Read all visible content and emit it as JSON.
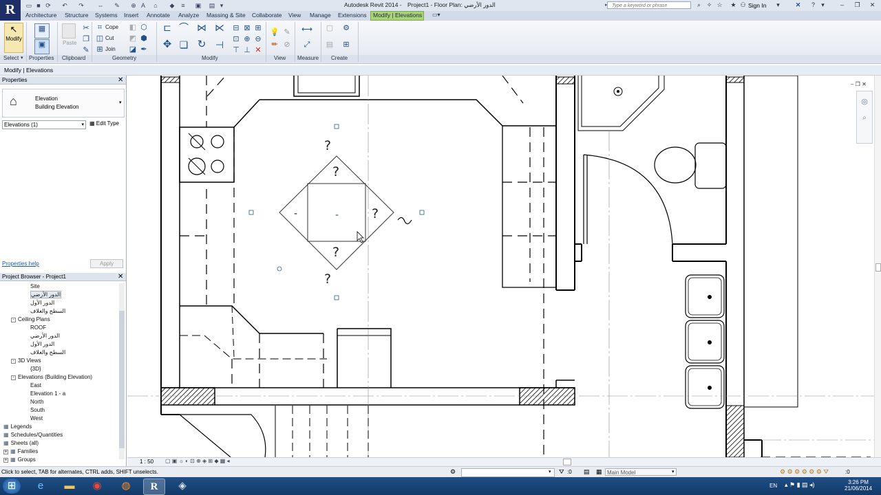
{
  "title_bar": {
    "app_title": "Autodesk Revit 2014 -",
    "doc_title": "Project1 - Floor Plan: الدور الأرضي",
    "search_placeholder": "Type a keyword or phrase",
    "sign_in": "Sign In",
    "app_logo": "R"
  },
  "tabs": [
    "Architecture",
    "Structure",
    "Systems",
    "Insert",
    "Annotate",
    "Analyze",
    "Massing & Site",
    "Collaborate",
    "View",
    "Manage",
    "Extensions",
    "Modify | Elevations"
  ],
  "ribbon": {
    "modify_label": "Modify",
    "paste_label": "Paste",
    "cope_label": "Cope",
    "cut_label": "Cut",
    "join_label": "Join",
    "panels": [
      "Select",
      "Properties",
      "Clipboard",
      "Geometry",
      "Modify",
      "View",
      "Measure",
      "Create"
    ]
  },
  "context_bar": {
    "label": "Modify | Elevations"
  },
  "properties": {
    "header": "Properties",
    "type_name": "Elevation",
    "type_sub": "Building Elevation",
    "instance_selector": "Elevations (1)",
    "edit_type": "Edit Type",
    "help_link": "Properties help",
    "apply_button": "Apply"
  },
  "project_browser": {
    "header": "Project Browser - Project1",
    "items": [
      {
        "label": "Site",
        "level": 2
      },
      {
        "label": "الدور الأرضي",
        "level": 2,
        "selected": true
      },
      {
        "label": "الدور الأول",
        "level": 2
      },
      {
        "label": "السطح والغلاف",
        "level": 2
      },
      {
        "label": "Ceiling Plans",
        "level": 1,
        "toggle": "-"
      },
      {
        "label": "ROOF",
        "level": 2
      },
      {
        "label": "الدور الأرضي",
        "level": 2
      },
      {
        "label": "الدور الأول",
        "level": 2
      },
      {
        "label": "السطح والغلاف",
        "level": 2
      },
      {
        "label": "3D Views",
        "level": 1,
        "toggle": "-"
      },
      {
        "label": "{3D}",
        "level": 2
      },
      {
        "label": "Elevations (Building Elevation)",
        "level": 1,
        "toggle": "-"
      },
      {
        "label": "East",
        "level": 2
      },
      {
        "label": "Elevation 1 - a",
        "level": 2
      },
      {
        "label": "North",
        "level": 2
      },
      {
        "label": "South",
        "level": 2
      },
      {
        "label": "West",
        "level": 2
      },
      {
        "label": "Legends",
        "level": 0,
        "icon": true
      },
      {
        "label": "Schedules/Quantities",
        "level": 0,
        "icon": true
      },
      {
        "label": "Sheets (all)",
        "level": 0,
        "icon": true
      },
      {
        "label": "Families",
        "level": 0,
        "toggle": "+",
        "icon": true
      },
      {
        "label": "Groups",
        "level": 0,
        "toggle": "+",
        "icon": true
      }
    ]
  },
  "drawing": {
    "elevation_marks": [
      "?",
      "?",
      "?",
      "?",
      "?"
    ],
    "dash_marks": [
      "-",
      "-"
    ]
  },
  "view_bar": {
    "scale": "1 : 50"
  },
  "status_bar": {
    "message": "Click to select, TAB for alternates, CTRL adds, SHIFT unselects.",
    "count": ":0",
    "model": "Main Model"
  },
  "taskbar": {
    "lang": "EN",
    "time": "3:26 PM",
    "date": "21/06/2014"
  },
  "colors": {
    "active_tab": "#a9d377",
    "ribbon_bg": "#eef1f6",
    "taskbar": "#1a4577",
    "wall_line": "#000000"
  }
}
